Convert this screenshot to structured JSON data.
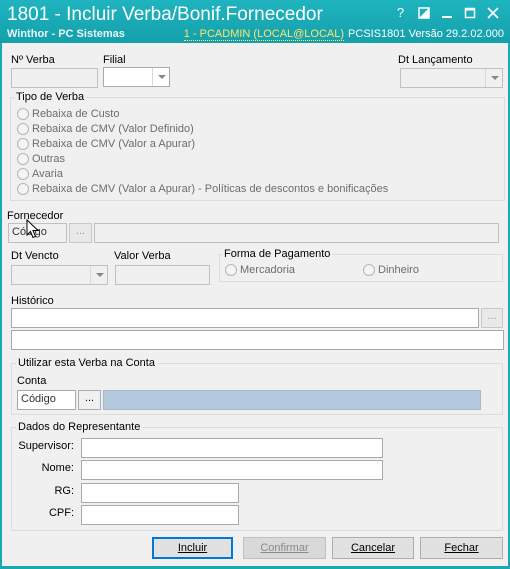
{
  "window": {
    "title": "1801 - Incluir Verba/Bonif.Fornecedor",
    "subtitle": "Winthor - PC Sistemas",
    "user": "1 - PCADMIN (LOCAL@LOCAL)",
    "info": "PCSIS1801  Versão  29.2.02.000",
    "buttons": {
      "help": "?",
      "restore": "◪",
      "minimize": "—",
      "maximize": "☐",
      "close": "✕"
    }
  },
  "fields": {
    "num_verba_label": "Nº Verba",
    "filial_label": "Filial",
    "dt_lancamento_label": "Dt Lançamento",
    "fornecedor_label": "Fornecedor",
    "fornecedor_codigo_placeholder": "Código",
    "dt_vencto_label": "Dt Vencto",
    "valor_verba_label": "Valor Verba",
    "historico_label": "Histórico"
  },
  "tipo_verba": {
    "title": "Tipo de Verba",
    "options": [
      "Rebaixa de Custo",
      "Rebaixa de CMV (Valor Definido)",
      "Rebaixa de CMV (Valor a Apurar)",
      "Outras",
      "Avaria",
      "Rebaixa de CMV (Valor a Apurar) - Políticas de descontos e bonificações"
    ]
  },
  "forma_pagamento": {
    "title": "Forma de Pagamento",
    "options": [
      "Mercadoria",
      "Dinheiro"
    ]
  },
  "conta": {
    "group_title": "Utilizar esta Verba na Conta",
    "label": "Conta",
    "codigo_placeholder": "Código",
    "lookup_button": "..."
  },
  "representante": {
    "group_title": "Dados do Representante",
    "supervisor_label": "Supervisor:",
    "nome_label": "Nome:",
    "rg_label": "RG:",
    "cpf_label": "CPF:"
  },
  "buttons": {
    "lookup": "...",
    "incluir": "Incluir",
    "confirmar": "Confirmar",
    "cancelar": "Cancelar",
    "fechar": "Fechar"
  }
}
